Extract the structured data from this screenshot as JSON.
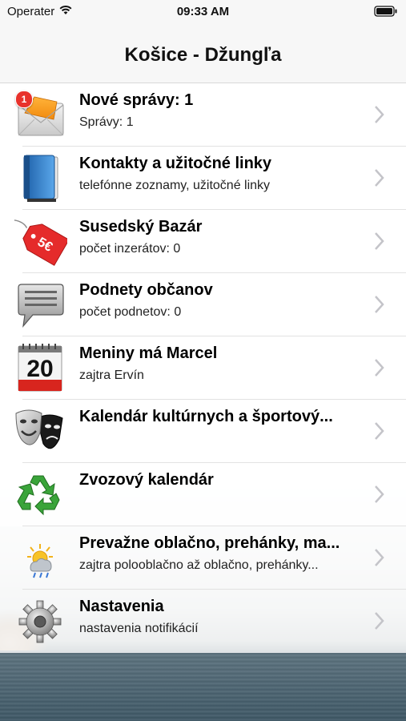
{
  "status_bar": {
    "carrier": "Operater",
    "time": "09:33 AM",
    "icons": [
      "wifi-icon",
      "battery-icon"
    ]
  },
  "nav": {
    "title": "Košice - Džungľa"
  },
  "list": {
    "rows": [
      {
        "icon": "mail-icon",
        "badge": "1",
        "title": "Nové správy: 1",
        "subtitle": "Správy: 1"
      },
      {
        "icon": "address-book-icon",
        "title": "Kontakty a užitočné linky",
        "subtitle": "telefónne zoznamy, užitočné linky"
      },
      {
        "icon": "price-tag-icon",
        "tag_text": "5€",
        "title": "Susedský Bazár",
        "subtitle": "počet inzerátov: 0"
      },
      {
        "icon": "speech-bubble-icon",
        "title": "Podnety občanov",
        "subtitle": "počet podnetov: 0"
      },
      {
        "icon": "calendar-icon",
        "calendar_day": "20",
        "title": "Meniny má Marcel",
        "subtitle": "zajtra Ervín"
      },
      {
        "icon": "theater-masks-icon",
        "title": "Kalendár kultúrnych a športový...",
        "subtitle": ""
      },
      {
        "icon": "recycle-icon",
        "title": "Zvozový kalendár",
        "subtitle": ""
      },
      {
        "icon": "weather-icon",
        "title": "Prevažne oblačno, prehánky, ma...",
        "subtitle": "zajtra polooblačno až oblačno, prehánky..."
      },
      {
        "icon": "settings-gear-icon",
        "title": "Nastavenia",
        "subtitle": "nastavenia notifikácií"
      }
    ]
  },
  "colors": {
    "badge": "#e8322c",
    "chevron": "#c4c4c9",
    "nav_background": "#f7f7f7"
  }
}
